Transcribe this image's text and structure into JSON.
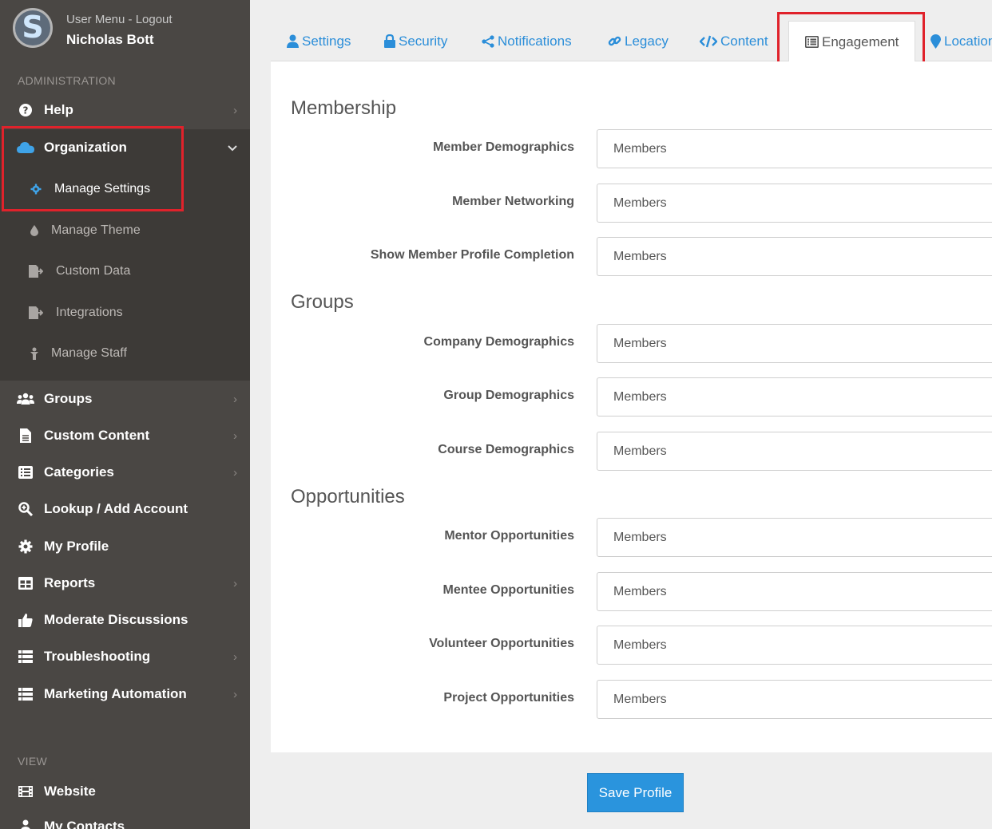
{
  "user": {
    "menu_text": "User Menu - Logout",
    "name": "Nicholas Bott",
    "logo_letter": "S"
  },
  "sidebar": {
    "admin_label": "ADMINISTRATION",
    "view_label": "VIEW",
    "items": {
      "help": "Help",
      "organization": "Organization",
      "groups": "Groups",
      "custom_content": "Custom Content",
      "categories": "Categories",
      "lookup": "Lookup / Add Account",
      "my_profile": "My Profile",
      "reports": "Reports",
      "moderate": "Moderate Discussions",
      "troubleshooting": "Troubleshooting",
      "marketing": "Marketing Automation",
      "website": "Website",
      "my_contacts": "My Contacts"
    },
    "sub_items": {
      "manage_settings": "Manage Settings",
      "manage_theme": "Manage Theme",
      "custom_data": "Custom Data",
      "integrations": "Integrations",
      "manage_staff": "Manage Staff"
    }
  },
  "tabs": {
    "settings": "Settings",
    "security": "Security",
    "notifications": "Notifications",
    "legacy": "Legacy",
    "content": "Content",
    "engagement": "Engagement",
    "location": "Location"
  },
  "form": {
    "membership": {
      "title": "Membership",
      "member_demographics": {
        "label": "Member Demographics",
        "value": "Members"
      },
      "member_networking": {
        "label": "Member Networking",
        "value": "Members"
      },
      "profile_completion": {
        "label": "Show Member Profile Completion",
        "value": "Members"
      }
    },
    "groups": {
      "title": "Groups",
      "company_demographics": {
        "label": "Company Demographics",
        "value": "Members"
      },
      "group_demographics": {
        "label": "Group Demographics",
        "value": "Members"
      },
      "course_demographics": {
        "label": "Course Demographics",
        "value": "Members"
      }
    },
    "opportunities": {
      "title": "Opportunities",
      "mentor": {
        "label": "Mentor Opportunities",
        "value": "Members"
      },
      "mentee": {
        "label": "Mentee Opportunities",
        "value": "Members"
      },
      "volunteer": {
        "label": "Volunteer Opportunities",
        "value": "Members"
      },
      "project": {
        "label": "Project Opportunities",
        "value": "Members"
      }
    }
  },
  "save_label": "Save Profile",
  "colors": {
    "accent": "#2a94dd",
    "sidebar": "#4a4744",
    "highlight": "#e0222b"
  }
}
